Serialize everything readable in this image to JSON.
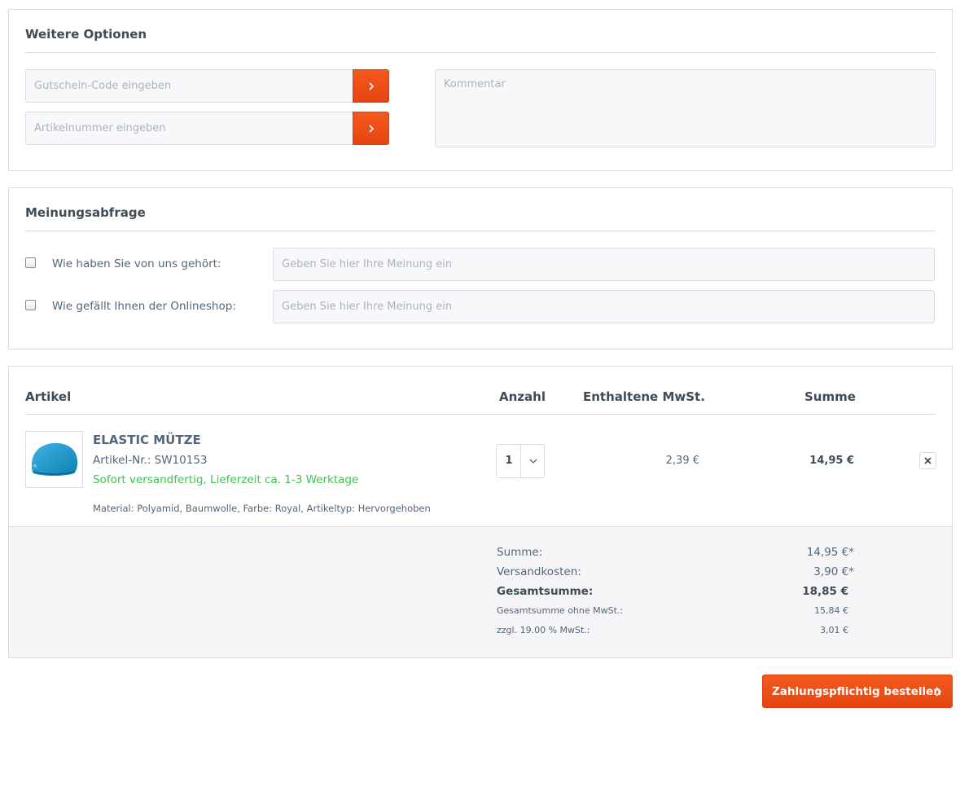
{
  "options": {
    "title": "Weitere Optionen",
    "voucher_placeholder": "Gutschein-Code eingeben",
    "article_placeholder": "Artikelnummer eingeben",
    "comment_placeholder": "Kommentar"
  },
  "survey": {
    "title": "Meinungsabfrage",
    "questions": [
      {
        "label": "Wie haben Sie von uns gehört:",
        "placeholder": "Geben Sie hier Ihre Meinung ein",
        "checked": false
      },
      {
        "label": "Wie gefällt Ihnen der Onlineshop:",
        "placeholder": "Geben Sie hier Ihre Meinung ein",
        "checked": false
      }
    ]
  },
  "cart": {
    "headers": {
      "article": "Artikel",
      "quantity": "Anzahl",
      "tax": "Enthaltene MwSt.",
      "sum": "Summe"
    },
    "item": {
      "name": "ELASTIC MÜTZE",
      "sku": "Artikel-Nr.: SW10153",
      "delivery": "Sofort versandfertig, Lieferzeit ca. 1-3 Werktage",
      "attributes": "Material: Polyamid, Baumwolle, Farbe: Royal, Artikeltyp: Hervorgehoben",
      "quantity": "1",
      "tax": "2,39 €",
      "sum": "14,95 €"
    },
    "totals": [
      {
        "label": "Summe:",
        "value": "14,95 €*"
      },
      {
        "label": "Versandkosten:",
        "value": "3,90 €*"
      },
      {
        "label": "Gesamtsumme:",
        "value": "18,85 €"
      },
      {
        "label": "Gesamtsumme ohne MwSt.:",
        "value": "15,84 €"
      },
      {
        "label": "zzgl. 19.00 % MwSt.:",
        "value": "3,01 €"
      }
    ]
  },
  "order_button": "Zahlungspflichtig bestellen",
  "colors": {
    "accent": "#e9490f",
    "delivery_green": "#3dc44e",
    "text": "#52667a",
    "border": "#dadae5"
  },
  "icons": {
    "submit": "chevron-right-icon",
    "quantity": "chevron-down-icon",
    "remove": "close-icon",
    "product": "product-thumbnail"
  }
}
